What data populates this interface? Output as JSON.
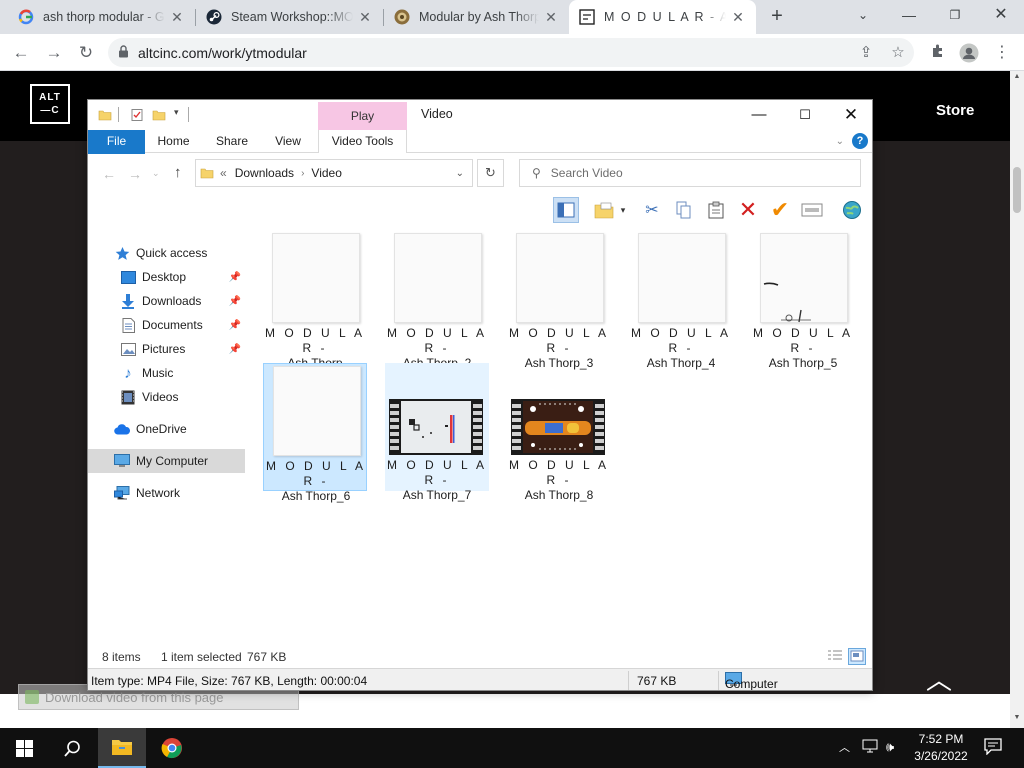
{
  "browser": {
    "tabs": [
      {
        "title": "ash thorp modular - Go",
        "favicon": "google-icon",
        "active": false
      },
      {
        "title": "Steam Workshop::MOD",
        "favicon": "steam-icon",
        "active": false
      },
      {
        "title": "Modular by Ash Thorp",
        "favicon": "modular-icon",
        "active": false
      },
      {
        "title": "M O D U L A R - Ash Th",
        "favicon": "altc-icon",
        "active": true
      }
    ],
    "url": "altcinc.com/work/ytmodular"
  },
  "webpage": {
    "logo_line1": "ALT",
    "logo_line2": "—C",
    "store_label": "Store",
    "download_bar_text": "Download video from this page"
  },
  "explorer": {
    "title": "Video",
    "contextual_group": "Play",
    "ribbon_tabs": [
      "File",
      "Home",
      "Share",
      "View",
      "Video Tools"
    ],
    "breadcrumb": [
      "Downloads",
      "Video"
    ],
    "breadcrumb_prefix": "«",
    "search_placeholder": "Search Video",
    "nav": [
      {
        "label": "Quick access",
        "icon": "star-icon"
      },
      {
        "label": "Desktop",
        "icon": "desktop-icon",
        "pinned": true
      },
      {
        "label": "Downloads",
        "icon": "downloads-icon",
        "pinned": true
      },
      {
        "label": "Documents",
        "icon": "documents-icon",
        "pinned": true
      },
      {
        "label": "Pictures",
        "icon": "pictures-icon",
        "pinned": true
      },
      {
        "label": "Music",
        "icon": "music-icon"
      },
      {
        "label": "Videos",
        "icon": "videos-icon"
      },
      {
        "label": "OneDrive",
        "icon": "cloud-icon"
      },
      {
        "label": "My Computer",
        "icon": "computer-icon",
        "selected": true
      },
      {
        "label": "Network",
        "icon": "network-icon"
      }
    ],
    "files": [
      {
        "line1": "M O D U L A R -",
        "line2": "Ash Thorp",
        "thumb": "blank"
      },
      {
        "line1": "M O D U L A R -",
        "line2": "Ash Thorp_2",
        "thumb": "blank"
      },
      {
        "line1": "M O D U L A R -",
        "line2": "Ash Thorp_3",
        "thumb": "blank"
      },
      {
        "line1": "M O D U L A R -",
        "line2": "Ash Thorp_4",
        "thumb": "blank"
      },
      {
        "line1": "M O D U L A R -",
        "line2": "Ash Thorp_5",
        "thumb": "sketch"
      },
      {
        "line1": "M O D U L A R -",
        "line2": "Ash Thorp_6",
        "thumb": "blank",
        "selected": true
      },
      {
        "line1": "M O D U L A R -",
        "line2": "Ash Thorp_7",
        "thumb": "film-light",
        "hovered": true
      },
      {
        "line1": "M O D U L A R -",
        "line2": "Ash Thorp_8",
        "thumb": "film-dark"
      }
    ],
    "status": {
      "items": "8 items",
      "selected": "1 item selected",
      "size": "767 KB"
    },
    "details": {
      "info": "Item type: MP4 File, Size: 767 KB, Length: 00:00:04",
      "size": "767 KB",
      "location": "Computer"
    }
  },
  "taskbar": {
    "time": "7:52 PM",
    "date": "3/26/2022"
  }
}
